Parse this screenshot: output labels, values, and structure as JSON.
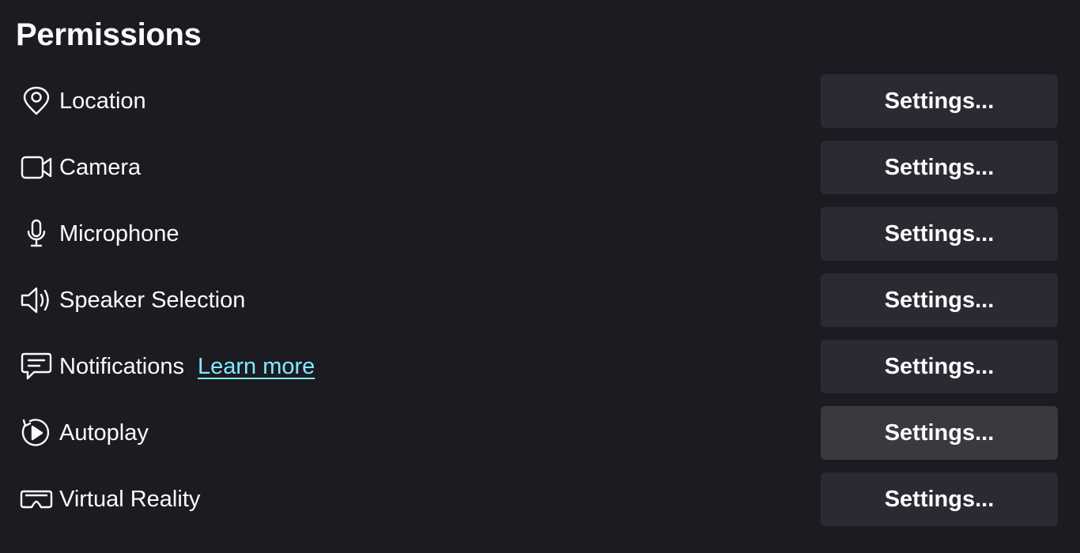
{
  "section": {
    "title": "Permissions"
  },
  "permissions": [
    {
      "label": "Location",
      "icon": "location-pin-icon",
      "button_label": "Settings..."
    },
    {
      "label": "Camera",
      "icon": "camera-icon",
      "button_label": "Settings..."
    },
    {
      "label": "Microphone",
      "icon": "microphone-icon",
      "button_label": "Settings..."
    },
    {
      "label": "Speaker Selection",
      "icon": "speaker-icon",
      "button_label": "Settings..."
    },
    {
      "label": "Notifications",
      "icon": "notification-icon",
      "button_label": "Settings...",
      "link_label": "Learn more"
    },
    {
      "label": "Autoplay",
      "icon": "autoplay-icon",
      "button_label": "Settings..."
    },
    {
      "label": "Virtual Reality",
      "icon": "vr-headset-icon",
      "button_label": "Settings..."
    }
  ],
  "colors": {
    "background": "#1c1b22",
    "text": "#fbfbfe",
    "button": "#2b2a33",
    "button_hover": "#3a3940",
    "link": "#80ebff"
  }
}
